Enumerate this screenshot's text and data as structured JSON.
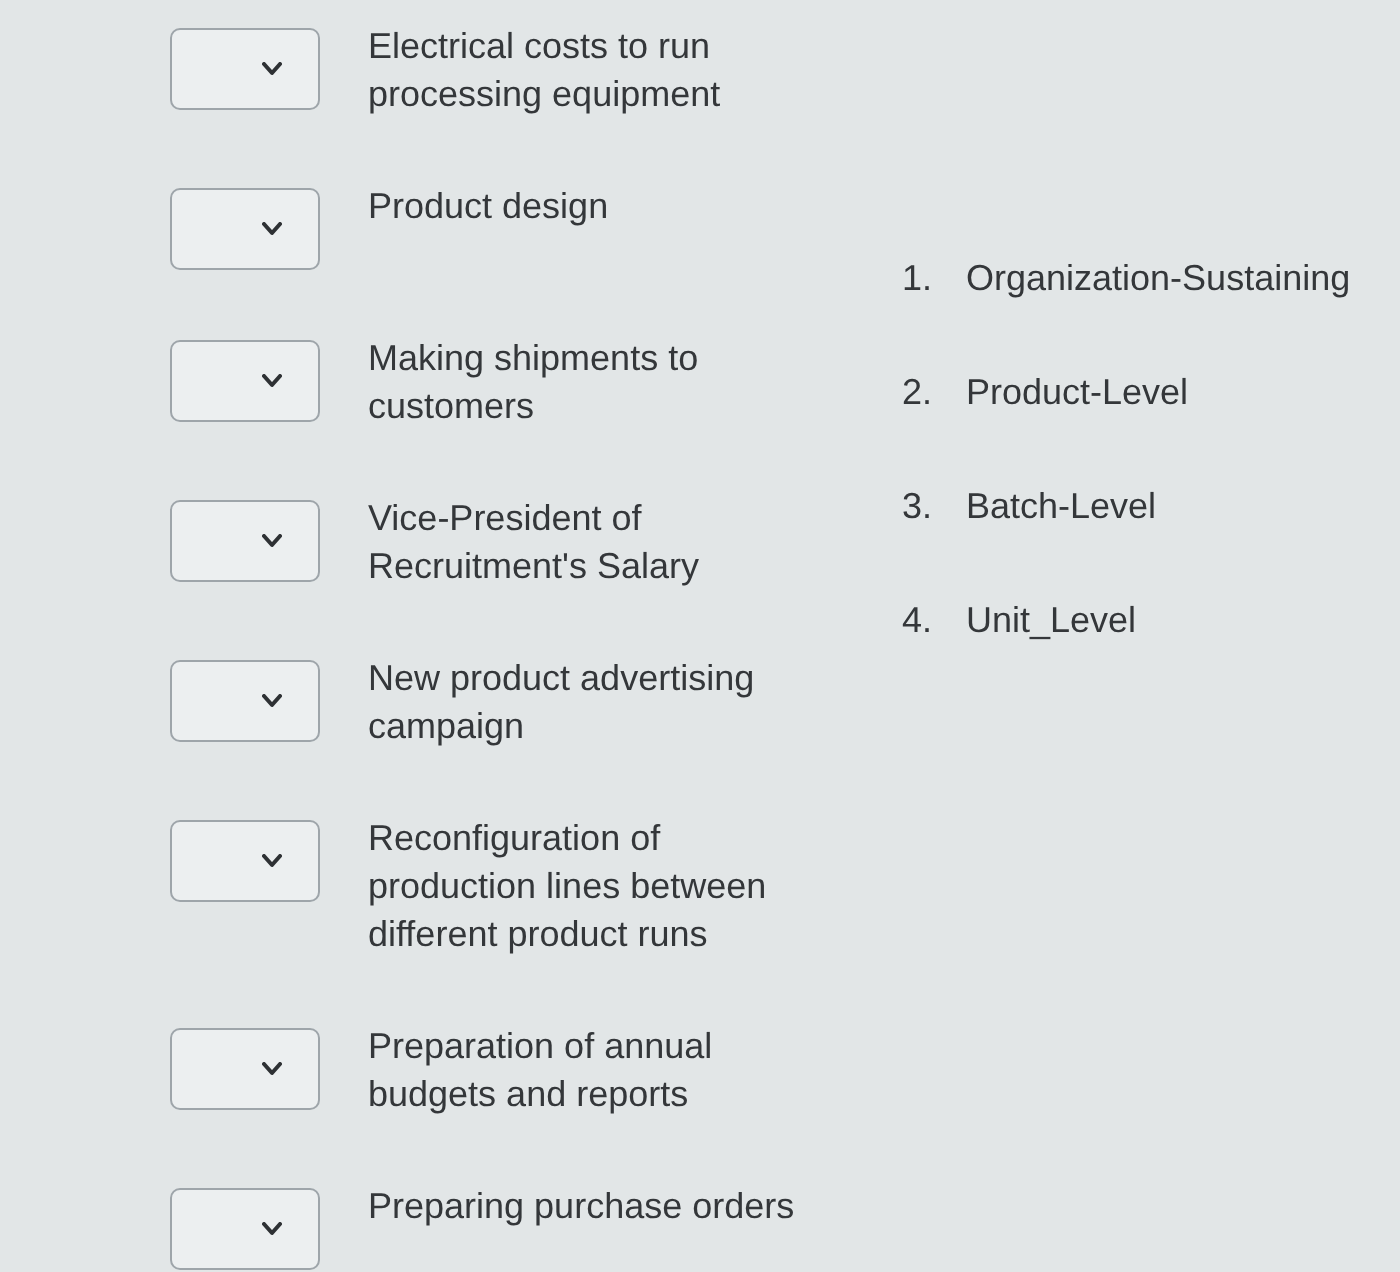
{
  "items": [
    {
      "description": "Electrical costs to run processing equipment"
    },
    {
      "description": "Product design"
    },
    {
      "description": "Making shipments to customers"
    },
    {
      "description": "Vice-President of Recruitment's Salary"
    },
    {
      "description": "New product advertising campaign"
    },
    {
      "description": "Reconfiguration of production lines between different product runs"
    },
    {
      "description": "Preparation of annual budgets and reports"
    },
    {
      "description": "Preparing purchase orders"
    }
  ],
  "options": [
    {
      "number": "1.",
      "label": "Organization-Sustaining"
    },
    {
      "number": "2.",
      "label": "Product-Level"
    },
    {
      "number": "3.",
      "label": "Batch-Level"
    },
    {
      "number": "4.",
      "label": "Unit_Level"
    }
  ]
}
